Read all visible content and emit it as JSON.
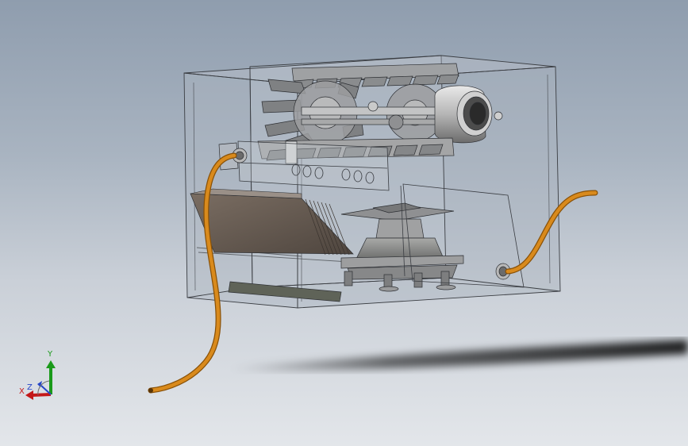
{
  "viewport": {
    "background_top": "#8f9dae",
    "background_bottom": "#e3e6ea"
  },
  "model": {
    "enclosure_color": "#3a3d42",
    "part_color": "#8e9094",
    "cable_color": "#d98a1c",
    "cable_stroke": "#8a5208",
    "fin_color": "#6e6258"
  },
  "triad": {
    "x_label": "X",
    "y_label": "Y",
    "z_label": "Z",
    "x_color": "#c41818",
    "y_color": "#1a9a1a",
    "z_color": "#2646c8"
  }
}
